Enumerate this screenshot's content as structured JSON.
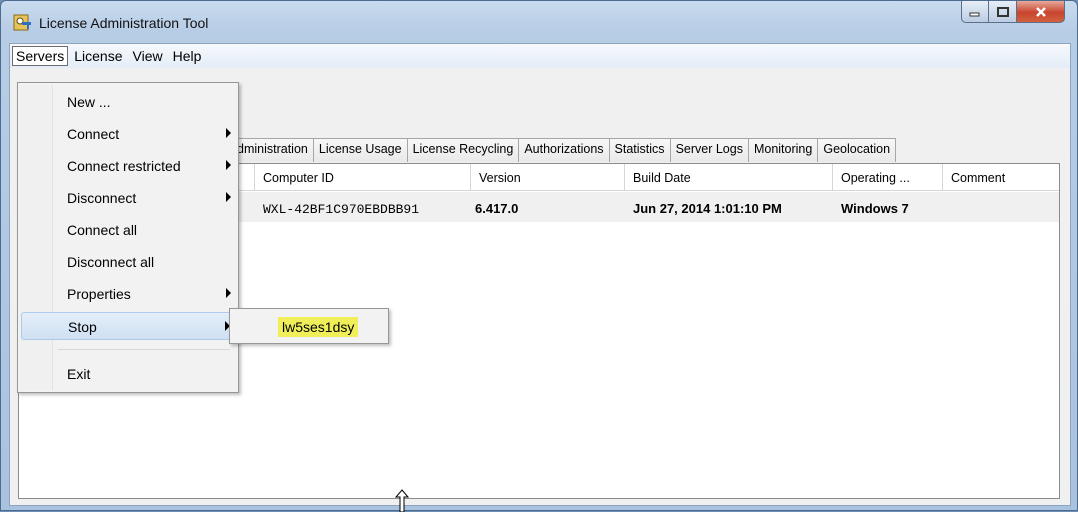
{
  "window": {
    "title": "License Administration Tool"
  },
  "menubar": {
    "items": [
      "Servers",
      "License",
      "View",
      "Help"
    ]
  },
  "servers_menu": {
    "items": [
      {
        "label": "New ...",
        "submenu": false
      },
      {
        "label": "Connect",
        "submenu": true
      },
      {
        "label": "Connect restricted",
        "submenu": true
      },
      {
        "label": "Disconnect",
        "submenu": true
      },
      {
        "label": "Connect all",
        "submenu": false
      },
      {
        "label": "Disconnect all",
        "submenu": false
      },
      {
        "label": "Properties",
        "submenu": true
      },
      {
        "label": "Stop",
        "submenu": true,
        "highlighted": true
      },
      {
        "label": "Exit",
        "submenu": false
      }
    ],
    "stop_submenu": [
      "lw5ses1dsy"
    ]
  },
  "tabs": [
    "dministration",
    "License Usage",
    "License Recycling",
    "Authorizations",
    "Statistics",
    "Server Logs",
    "Monitoring",
    "Geolocation"
  ],
  "table": {
    "columns": [
      "Computer ID",
      "Version",
      "Build Date",
      "Operating ...",
      "Comment"
    ],
    "rows": [
      {
        "computer_id": "WXL-42BF1C970EBDBB91",
        "version": "6.417.0",
        "build_date": "Jun 27, 2014 1:01:10 PM",
        "os": "Windows 7",
        "comment": ""
      }
    ]
  },
  "colors": {
    "highlight": "#f0ef5a",
    "menu_hover": "#cfe0f3",
    "close_button": "#c8452f"
  },
  "icons": [
    "app-keys-icon",
    "minimize-icon",
    "maximize-icon",
    "close-icon",
    "submenu-arrow-icon",
    "resize-arrow-icon"
  ]
}
